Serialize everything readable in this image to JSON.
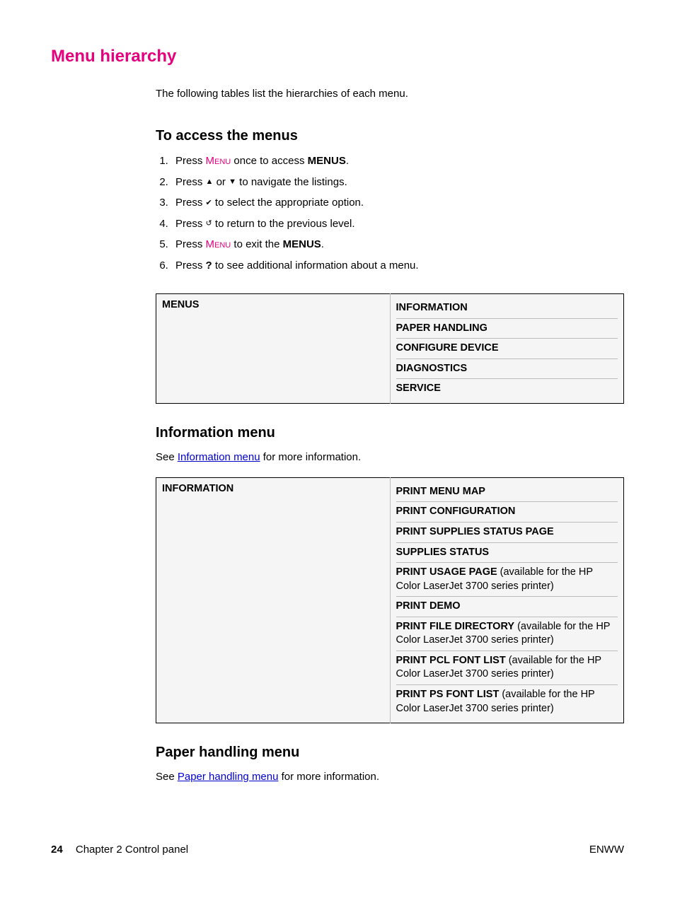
{
  "main_title": "Menu hierarchy",
  "intro": "The following tables list the hierarchies of each menu.",
  "section_access": {
    "heading": "To access the menus",
    "steps": {
      "s1_a": "Press ",
      "s1_key": "Menu",
      "s1_b": " once to access ",
      "s1_bold": "MENUS",
      "s1_c": ".",
      "s2_a": "Press ",
      "s2_b": " or ",
      "s2_c": " to navigate the listings.",
      "s3_a": "Press ",
      "s3_b": " to select the appropriate option.",
      "s4_a": "Press ",
      "s4_b": " to return to the previous level.",
      "s5_a": "Press ",
      "s5_key": "Menu",
      "s5_b": " to exit the ",
      "s5_bold": "MENUS",
      "s5_c": ".",
      "s6_a": "Press ",
      "s6_q": "?",
      "s6_b": " to see additional information about a menu."
    }
  },
  "table_menus": {
    "left": "MENUS",
    "items": [
      {
        "label": "INFORMATION",
        "note": ""
      },
      {
        "label": "PAPER HANDLING",
        "note": ""
      },
      {
        "label": "CONFIGURE DEVICE",
        "note": ""
      },
      {
        "label": "DIAGNOSTICS",
        "note": ""
      },
      {
        "label": "SERVICE",
        "note": ""
      }
    ]
  },
  "section_info": {
    "heading": "Information menu",
    "see_a": "See ",
    "see_link": "Information menu",
    "see_b": " for more information."
  },
  "table_info": {
    "left": "INFORMATION",
    "items": [
      {
        "label": "PRINT MENU MAP",
        "note": ""
      },
      {
        "label": "PRINT CONFIGURATION",
        "note": ""
      },
      {
        "label": "PRINT SUPPLIES STATUS PAGE",
        "note": ""
      },
      {
        "label": "SUPPLIES STATUS",
        "note": ""
      },
      {
        "label": "PRINT USAGE PAGE",
        "note": " (available for the HP Color LaserJet 3700 series printer)"
      },
      {
        "label": "PRINT DEMO",
        "note": ""
      },
      {
        "label": "PRINT FILE DIRECTORY",
        "note": " (available for the HP Color LaserJet 3700 series printer)"
      },
      {
        "label": "PRINT PCL FONT LIST",
        "note": " (available for the HP Color LaserJet 3700 series printer)"
      },
      {
        "label": "PRINT PS FONT LIST",
        "note": " (available for the HP Color LaserJet 3700 series printer)"
      }
    ]
  },
  "section_paper": {
    "heading": "Paper handling menu",
    "see_a": "See ",
    "see_link": "Paper handling menu",
    "see_b": " for more information."
  },
  "footer": {
    "page": "24",
    "chapter": "Chapter 2  Control panel",
    "right": "ENWW"
  }
}
